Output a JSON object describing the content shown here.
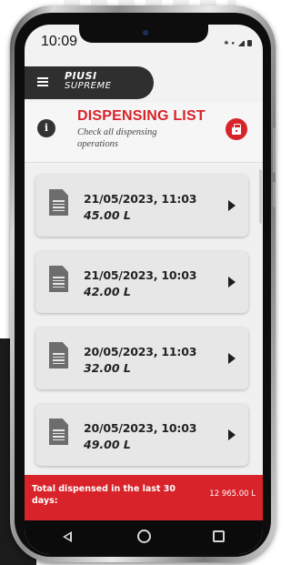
{
  "status_bar": {
    "time": "10:09",
    "icons": [
      "bluetooth-icon",
      "wifi-icon",
      "signal-icon",
      "battery-icon"
    ]
  },
  "app_header": {
    "logo_line1": "PIUSI",
    "logo_line2": "SUPREME",
    "menu_icon": "hamburger-menu-icon"
  },
  "page": {
    "title": "DISPENSING LIST",
    "subtitle": "Check all dispensing operations",
    "info_icon_glyph": "i",
    "export_icon": "briefcase-icon"
  },
  "dispensings": [
    {
      "date": "21/05/2023, 11:03",
      "volume": "45.00 L"
    },
    {
      "date": "21/05/2023, 10:03",
      "volume": "42.00 L"
    },
    {
      "date": "20/05/2023, 11:03",
      "volume": "32.00 L"
    },
    {
      "date": "20/05/2023, 10:03",
      "volume": "49.00 L"
    }
  ],
  "footer": {
    "total_label": "Total dispensed in the last 30 days:",
    "total_value": "12 965.00 L"
  },
  "nav_bar": {
    "icons": [
      "back-icon",
      "home-icon",
      "recents-icon"
    ]
  },
  "colors": {
    "accent": "#d8232a",
    "header": "#2f2f2f",
    "card": "#e7e7e7",
    "background": "#f0f0f0"
  }
}
